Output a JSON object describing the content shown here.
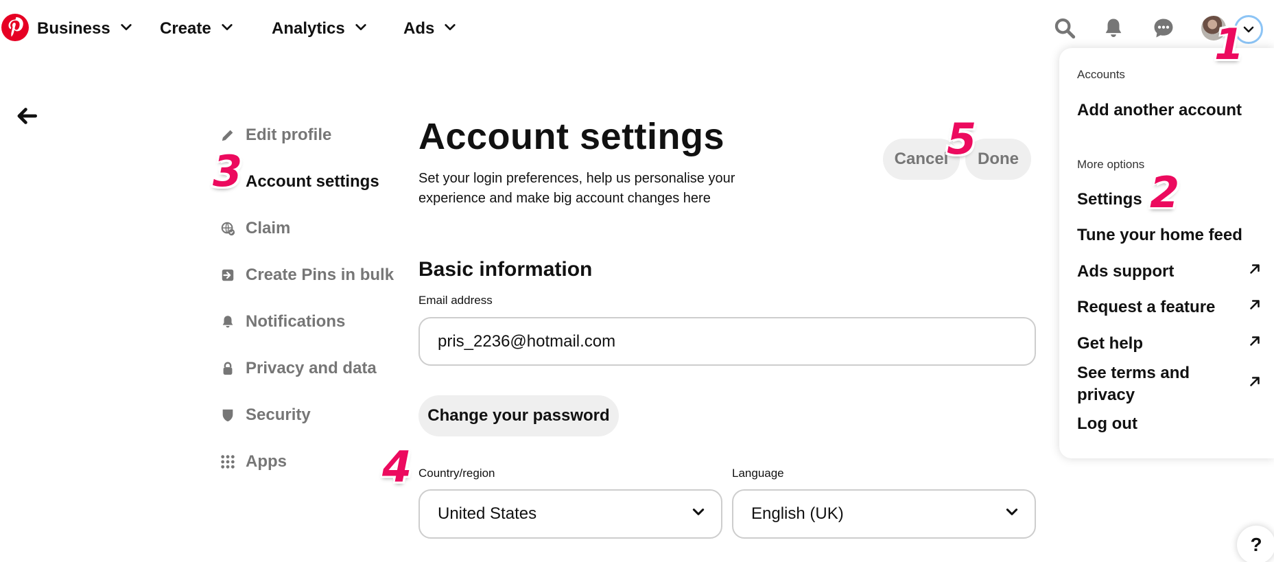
{
  "topnav": {
    "items": [
      {
        "label": "Business"
      },
      {
        "label": "Create"
      },
      {
        "label": "Analytics"
      },
      {
        "label": "Ads"
      }
    ],
    "icons": [
      "pinterest-logo-icon",
      "search-icon",
      "bell-icon",
      "chat-icon",
      "chevron-down-icon"
    ]
  },
  "sidebar": {
    "items": [
      {
        "label": "Edit profile",
        "icon": "pencil-icon"
      },
      {
        "label": "Account settings",
        "icon": "none",
        "active": true
      },
      {
        "label": "Claim",
        "icon": "globe-check-icon"
      },
      {
        "label": "Create Pins in bulk",
        "icon": "import-icon"
      },
      {
        "label": "Notifications",
        "icon": "bell-icon"
      },
      {
        "label": "Privacy and data",
        "icon": "lock-icon"
      },
      {
        "label": "Security",
        "icon": "shield-icon"
      },
      {
        "label": "Apps",
        "icon": "grid-icon"
      }
    ]
  },
  "main": {
    "title": "Account settings",
    "description": "Set your login preferences, help us personalise your experience and make big account changes here",
    "cancel_label": "Cancel",
    "done_label": "Done",
    "section_title": "Basic information",
    "email_label": "Email address",
    "email_value": "pris_2236@hotmail.com",
    "change_password_label": "Change your password",
    "country_label": "Country/region",
    "country_value": "United States",
    "language_label": "Language",
    "language_value": "English (UK)"
  },
  "menu": {
    "accounts_heading": "Accounts",
    "add_account": "Add another account",
    "more_options_heading": "More options",
    "items": [
      {
        "label": "Settings",
        "external": false
      },
      {
        "label": "Tune your home feed",
        "external": false
      },
      {
        "label": "Ads support",
        "external": true
      },
      {
        "label": "Request a feature",
        "external": true
      },
      {
        "label": "Get help",
        "external": true
      },
      {
        "label": "See terms and privacy",
        "external": true
      },
      {
        "label": "Log out",
        "external": false
      }
    ]
  },
  "help_label": "?",
  "steps": [
    "1",
    "2",
    "3",
    "4",
    "5"
  ],
  "colors": {
    "brand": "#e60023",
    "step_annotation": "#ec0a5e",
    "pill_bg": "#efefef",
    "muted_text": "#767676"
  }
}
